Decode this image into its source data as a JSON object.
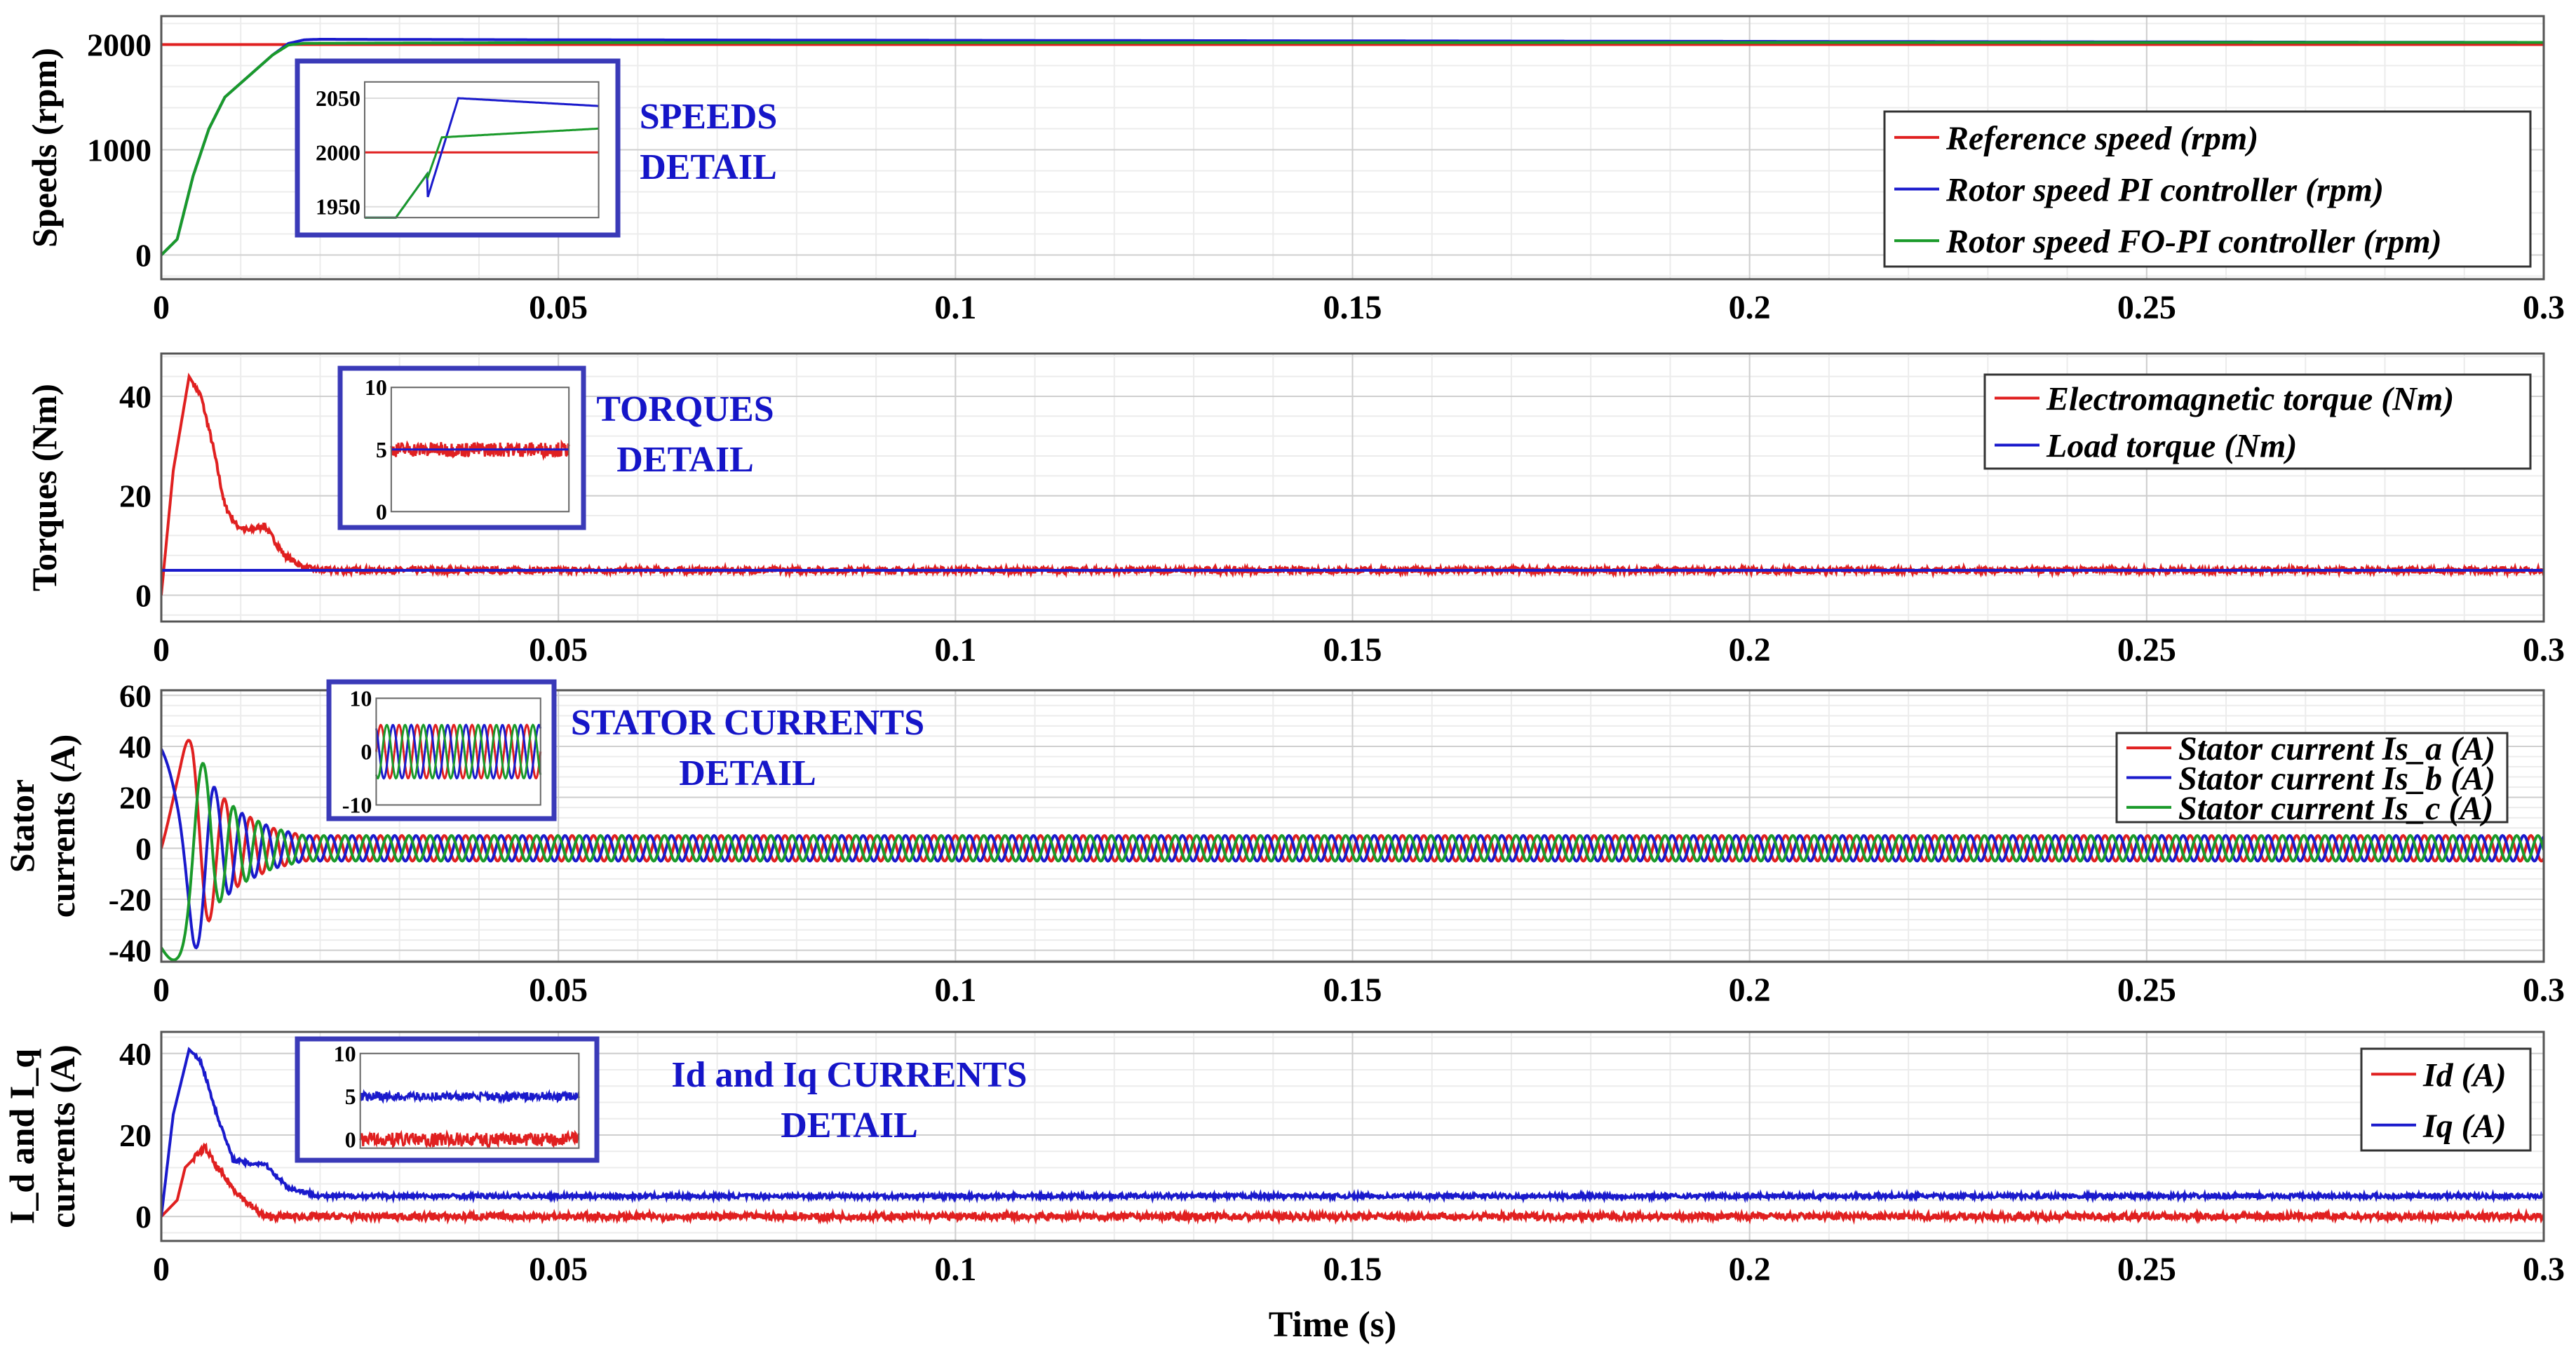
{
  "chart_data": {
    "type": "line",
    "xlabel": "Time (s)",
    "xlim": [
      0,
      0.3
    ],
    "xticks": [
      0,
      0.05,
      0.1,
      0.15,
      0.2,
      0.25,
      0.3
    ],
    "xtick_labels": [
      "0",
      "0.05",
      "0.1",
      "0.15",
      "0.2",
      "0.25",
      "0.3"
    ],
    "grid": true,
    "panels": [
      {
        "ylabel": [
          "Speeds (rpm)"
        ],
        "ylim": [
          -230,
          2270
        ],
        "yticks": [
          0,
          1000,
          2000
        ],
        "legend_placement": "right",
        "series": [
          {
            "name": "Reference speed (rpm)",
            "color": "#e02020",
            "kind": "pts",
            "points": [
              [
                0,
                2000
              ],
              [
                0.3,
                2000
              ]
            ]
          },
          {
            "name": "Rotor speed PI controller (rpm)",
            "color": "#1a1acc",
            "kind": "pts",
            "points": [
              [
                0,
                0
              ],
              [
                0.002,
                150
              ],
              [
                0.004,
                750
              ],
              [
                0.006,
                1200
              ],
              [
                0.008,
                1500
              ],
              [
                0.011,
                1700
              ],
              [
                0.014,
                1900
              ],
              [
                0.016,
                2010
              ],
              [
                0.018,
                2045
              ],
              [
                0.02,
                2050
              ],
              [
                0.05,
                2045
              ],
              [
                0.3,
                2020
              ]
            ]
          },
          {
            "name": "Rotor speed FO-PI controller (rpm)",
            "color": "#1a9a2a",
            "kind": "pts",
            "points": [
              [
                0,
                0
              ],
              [
                0.002,
                150
              ],
              [
                0.004,
                750
              ],
              [
                0.006,
                1200
              ],
              [
                0.008,
                1500
              ],
              [
                0.011,
                1700
              ],
              [
                0.014,
                1900
              ],
              [
                0.016,
                1995
              ],
              [
                0.018,
                2012
              ],
              [
                0.05,
                2018
              ],
              [
                0.3,
                2020
              ]
            ]
          }
        ],
        "inset": {
          "title": [
            "SPEEDS",
            "DETAIL"
          ],
          "ylim": [
            1940,
            2065
          ],
          "yticks": [
            1950,
            2000,
            2050
          ]
        }
      },
      {
        "ylabel": [
          "Torques (Nm)"
        ],
        "ylim": [
          -5.3,
          48.6
        ],
        "yticks": [
          0,
          20,
          40
        ],
        "legend_placement": "top-right",
        "series": [
          {
            "name": "Electromagnetic torque (Nm)",
            "color": "#e02020",
            "kind": "pts",
            "noise": 0.6,
            "points": [
              [
                0,
                0
              ],
              [
                0.0015,
                25
              ],
              [
                0.0035,
                44
              ],
              [
                0.005,
                40
              ],
              [
                0.0065,
                30
              ],
              [
                0.008,
                18
              ],
              [
                0.0095,
                14
              ],
              [
                0.011,
                13
              ],
              [
                0.013,
                14
              ],
              [
                0.0155,
                8
              ],
              [
                0.018,
                5.5
              ],
              [
                0.02,
                5
              ],
              [
                0.3,
                5
              ]
            ]
          },
          {
            "name": "Load torque (Nm)",
            "color": "#1a1acc",
            "kind": "pts",
            "points": [
              [
                0,
                5
              ],
              [
                0.3,
                5
              ]
            ]
          }
        ],
        "inset": {
          "title": [
            "TORQUES",
            "DETAIL"
          ],
          "ylim": [
            0,
            10
          ],
          "yticks": [
            0,
            5,
            10
          ]
        }
      },
      {
        "ylabel": [
          "Stator",
          "currents (A)"
        ],
        "ylim": [
          -44.5,
          62
        ],
        "yticks": [
          -40,
          -20,
          0,
          20,
          40,
          60
        ],
        "legend_placement": "top-right",
        "steady_amplitude_A": 5,
        "steady_frequency_hz": 333,
        "envelope": [
          [
            0,
            45
          ],
          [
            0.004,
            42
          ],
          [
            0.007,
            22
          ],
          [
            0.01,
            14
          ],
          [
            0.014,
            8
          ],
          [
            0.018,
            5
          ],
          [
            0.3,
            5
          ]
        ],
        "series": [
          {
            "name": "Stator current Is_a (A)",
            "color": "#e02020",
            "kind": "sine",
            "phase_deg": 0
          },
          {
            "name": "Stator current Is_b (A)",
            "color": "#1a1acc",
            "kind": "sine",
            "phase_deg": 120
          },
          {
            "name": "Stator current Is_c (A)",
            "color": "#1a9a2a",
            "kind": "sine",
            "phase_deg": -120
          }
        ],
        "inset": {
          "title": [
            "STATOR CURRENTS",
            "DETAIL"
          ],
          "ylim": [
            -10,
            10
          ],
          "yticks": [
            -10,
            0,
            10
          ]
        }
      },
      {
        "ylabel": [
          "I_d and I_q",
          "currents (A)"
        ],
        "ylim": [
          -6,
          45.3
        ],
        "yticks": [
          0,
          20,
          40
        ],
        "legend_placement": "right",
        "series": [
          {
            "name": "Id (A)",
            "color": "#e02020",
            "kind": "pts",
            "noise": 0.8,
            "points": [
              [
                0,
                0
              ],
              [
                0.002,
                4
              ],
              [
                0.003,
                12
              ],
              [
                0.0055,
                17
              ],
              [
                0.007,
                12
              ],
              [
                0.009,
                7
              ],
              [
                0.011,
                3
              ],
              [
                0.013,
                0
              ],
              [
                0.3,
                0
              ]
            ]
          },
          {
            "name": "Iq (A)",
            "color": "#1a1acc",
            "kind": "pts",
            "noise": 0.5,
            "points": [
              [
                0,
                0
              ],
              [
                0.0015,
                25
              ],
              [
                0.0035,
                41
              ],
              [
                0.005,
                38
              ],
              [
                0.007,
                25
              ],
              [
                0.009,
                14
              ],
              [
                0.011,
                13
              ],
              [
                0.013,
                13
              ],
              [
                0.016,
                7
              ],
              [
                0.02,
                5
              ],
              [
                0.3,
                5
              ]
            ]
          }
        ],
        "inset": {
          "title": [
            "Id and Iq CURRENTS",
            "DETAIL"
          ],
          "ylim": [
            -1,
            10
          ],
          "yticks": [
            0,
            5,
            10
          ]
        }
      }
    ]
  }
}
